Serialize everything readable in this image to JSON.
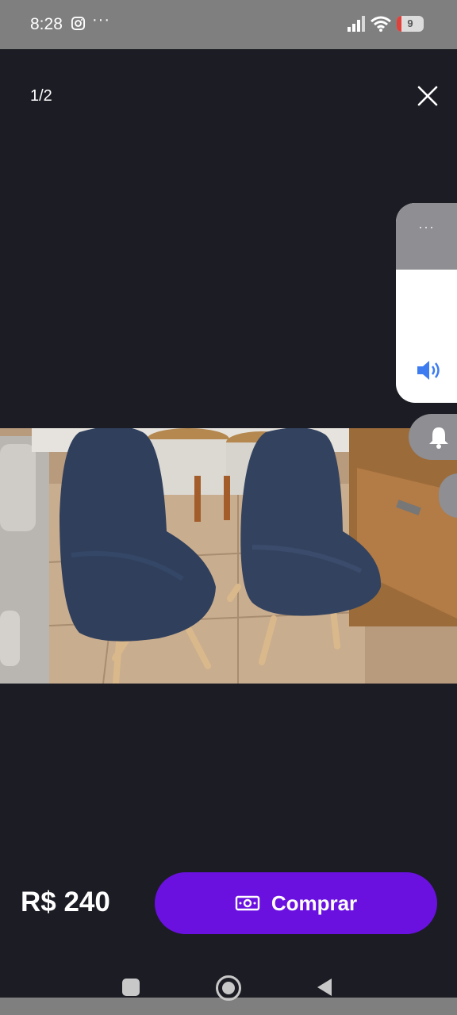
{
  "status_bar": {
    "time": "8:28",
    "more": "···",
    "battery_level": "9",
    "icons": [
      "instagram-icon",
      "signal-icon",
      "wifi-icon",
      "battery-icon"
    ]
  },
  "viewer": {
    "counter": "1/2",
    "close_icon": "close-icon"
  },
  "volume_panel": {
    "more": "···",
    "icon": "speaker-icon",
    "bell_icon": "bell-icon"
  },
  "footer": {
    "price": "R$ 240",
    "buy_label": "Comprar",
    "buy_icon": "money-icon",
    "accent_color": "#6a11e0"
  },
  "nav": {
    "icons": [
      "recent-apps-icon",
      "home-icon",
      "back-icon"
    ]
  }
}
